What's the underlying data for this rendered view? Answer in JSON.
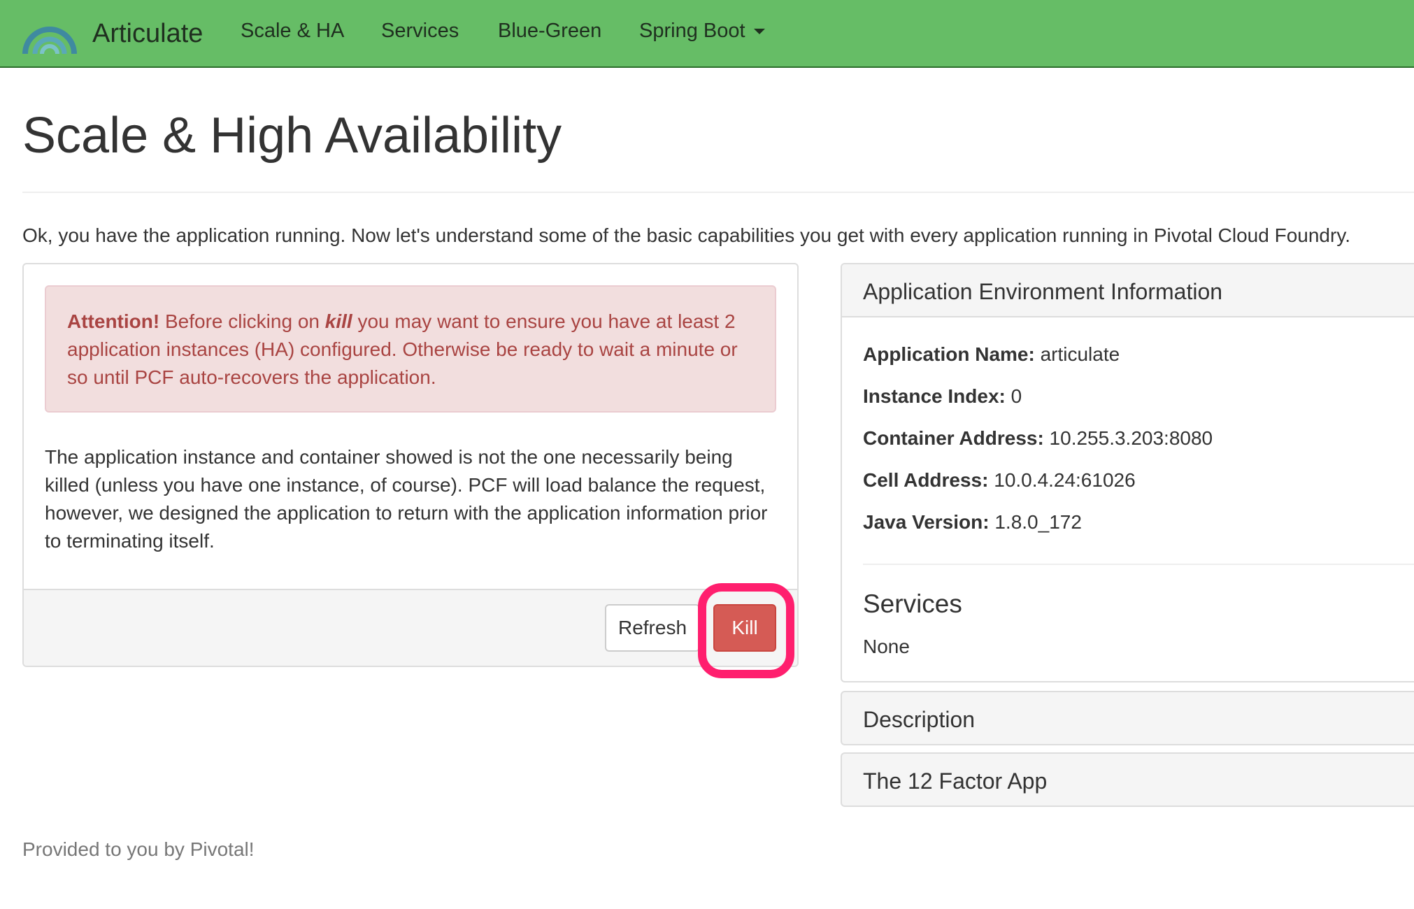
{
  "navbar": {
    "brand": "Articulate",
    "links": [
      "Scale & HA",
      "Services",
      "Blue-Green",
      "Spring Boot"
    ],
    "brand_color": "#66bd66"
  },
  "page": {
    "title": "Scale & High Availability",
    "intro": "Ok, you have the application running. Now let's understand some of the basic capabilities you get with every application running in Pivotal Cloud Foundry."
  },
  "left_panel": {
    "alert": {
      "strong": "Attention!",
      "text_before": " Before clicking on ",
      "emphasis": "kill",
      "text_after": " you may want to ensure you have at least 2 application instances (HA) configured. Otherwise be ready to wait a minute or so until PCF auto-recovers the application."
    },
    "body": "The application instance and container showed is not the one necessarily being killed (unless you have one instance, of course). PCF will load balance the request, however, we designed the application to return with the application information prior to terminating itself.",
    "refresh_label": "Refresh",
    "kill_label": "Kill",
    "highlight_color": "#ff1f6e"
  },
  "right_panel": {
    "heading": "Application Environment Information",
    "rows": [
      {
        "label": "Application Name:",
        "value": " articulate"
      },
      {
        "label": "Instance Index:",
        "value": " 0"
      },
      {
        "label": "Container Address:",
        "value": " 10.255.3.203:8080"
      },
      {
        "label": "Cell Address:",
        "value": " 10.0.4.24:61026"
      },
      {
        "label": "Java Version:",
        "value": " 1.8.0_172"
      }
    ],
    "services_heading": "Services",
    "services_value": "None"
  },
  "collapsed_panels": [
    "Description",
    "The 12 Factor App"
  ],
  "footer": "Provided to you by Pivotal!"
}
